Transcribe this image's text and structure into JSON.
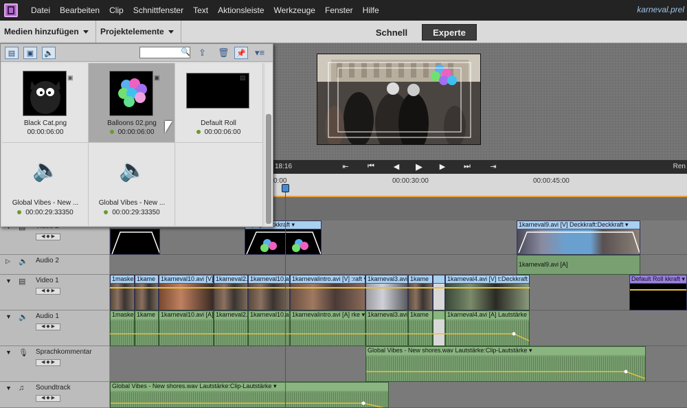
{
  "menubar": {
    "items": [
      "Datei",
      "Bearbeiten",
      "Clip",
      "Schnittfenster",
      "Text",
      "Aktionsleiste",
      "Werkzeuge",
      "Fenster",
      "Hilfe"
    ],
    "project_title": "karneval.prel"
  },
  "header": {
    "add_media": "Medien hinzufügen",
    "project_assets": "Projektelemente",
    "mode_quick": "Schnell",
    "mode_expert": "Experte"
  },
  "panel": {
    "search_value": "",
    "tiles": [
      {
        "name": "Black Cat.png",
        "duration": "00:00:06:00",
        "has_dot": false
      },
      {
        "name": "Balloons 02.png",
        "duration": "00:00:06:00",
        "has_dot": true
      },
      {
        "name": "Default Roll",
        "duration": "00:00:06:00",
        "has_dot": true
      },
      {
        "name": "Global Vibes - New ...",
        "duration": "00:00:29:33350",
        "has_dot": true
      },
      {
        "name": "Global Vibes - New ...",
        "duration": "00:00:29:33350",
        "has_dot": true
      }
    ]
  },
  "monitor": {
    "timecode_left": "18:16",
    "right_label": "Ren"
  },
  "ruler": {
    "labels": [
      "00:00:30:00",
      "00:00:45:00"
    ],
    "first_label": "0:00"
  },
  "tracks": [
    {
      "name": "Video 2",
      "type": "video"
    },
    {
      "name": "Audio 2",
      "type": "audio"
    },
    {
      "name": "Video 1",
      "type": "video"
    },
    {
      "name": "Audio 1",
      "type": "audio"
    },
    {
      "name": "Sprachkommentar",
      "type": "narration"
    },
    {
      "name": "Soundtrack",
      "type": "soundtrack"
    }
  ],
  "clips": {
    "v2_a": "2.png  Deckkraft ▾",
    "v2_b": "1karneval9.avi [V]   Deckkraft:Deckkraft ▾",
    "a2_b": "1karneval9.avi [A]",
    "v1": [
      "1maske",
      "1kame",
      "1karneval10.avi [V]",
      "1karneval2.",
      "1karneval10.a",
      "1karnevalintro.avi [V]   :raft ▾",
      "1karneval3.avi",
      "1kame",
      "",
      "1karneval4.avi [V]   t:Deckkraft ▾"
    ],
    "v1_roll": "Default Roll   kkraft ▾",
    "a1": [
      "1maske",
      "1kame",
      "1karneval10.avi [A]",
      "1karneval2.",
      "1karneval10.a",
      "1karnevalintro.avi [A]   rke ▾",
      "1karneval3.avi",
      "1kame",
      "",
      "1karneval4.avi [A]   Lautstärke ▾"
    ],
    "narration": "Global Vibes - New shores.wav   Lautstärke:Clip-Lautstärke ▾",
    "soundtrack": "Global Vibes - New shores.wav   Lautstärke:Clip-Lautstärke ▾"
  }
}
